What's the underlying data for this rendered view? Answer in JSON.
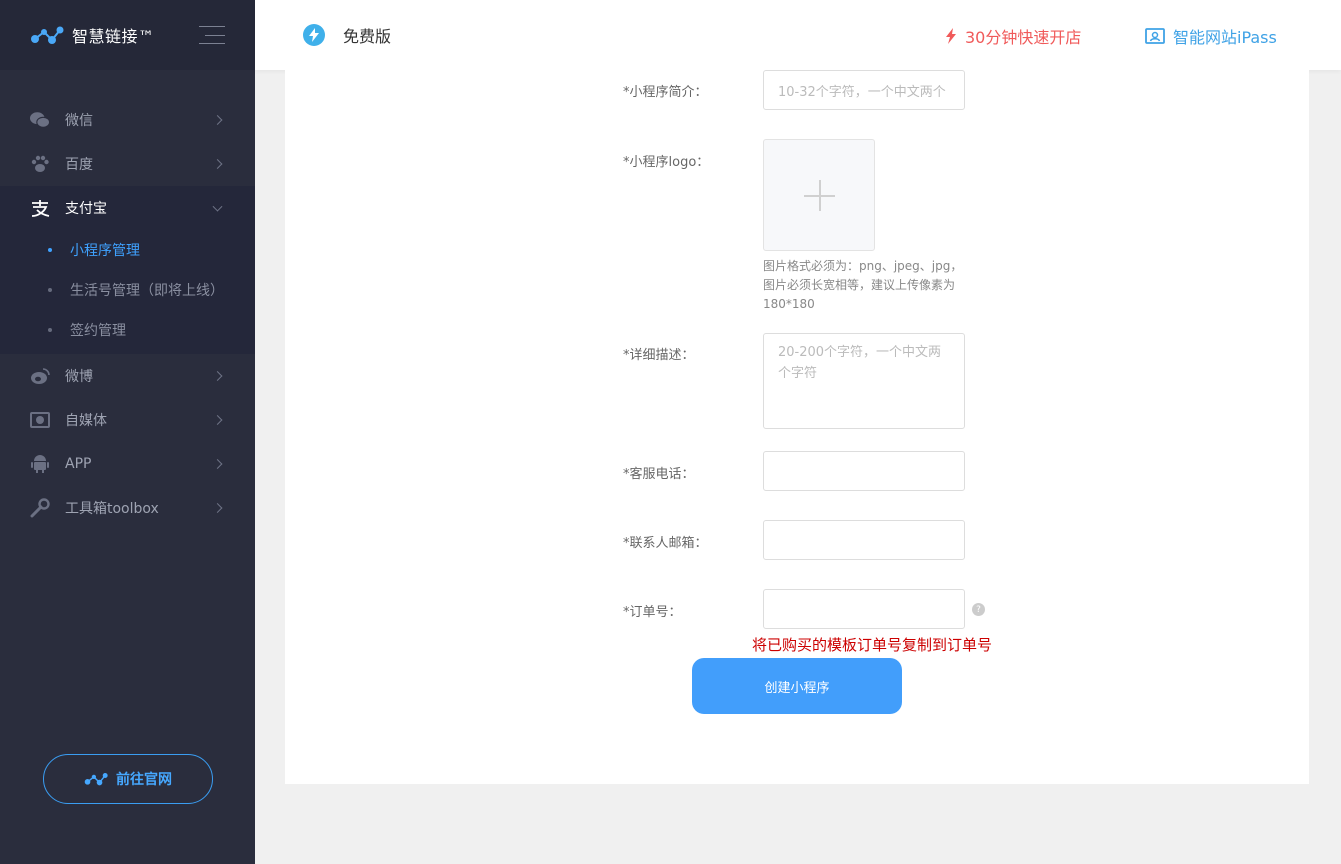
{
  "brand": {
    "name": "智慧链接™"
  },
  "sidebar": {
    "items": [
      {
        "label": "微信",
        "icon": "wechat-icon"
      },
      {
        "label": "百度",
        "icon": "paw-icon"
      },
      {
        "label": "支付宝",
        "icon": "alipay-icon",
        "expanded": true
      },
      {
        "label": "微博",
        "icon": "weibo-icon"
      },
      {
        "label": "自媒体",
        "icon": "camera-icon"
      },
      {
        "label": "APP",
        "icon": "android-icon"
      },
      {
        "label": "工具箱toolbox",
        "icon": "wrench-icon"
      }
    ],
    "alipay_sub": [
      {
        "label": "小程序管理",
        "active": true
      },
      {
        "label": "生活号管理（即将上线）"
      },
      {
        "label": "签约管理"
      }
    ],
    "goto_label": "前往官网"
  },
  "header": {
    "edition": "免费版",
    "quick_open": "30分钟快速开店",
    "ipass": "智能网站iPass"
  },
  "form": {
    "intro_label": "*小程序简介：",
    "intro_placeholder": "10-32个字符，一个中文两个",
    "logo_label": "*小程序logo：",
    "logo_hint": "图片格式必须为：png、jpeg、jpg，图片必须长宽相等，建议上传像素为180*180",
    "desc_label": "*详细描述：",
    "desc_placeholder": "20-200个字符，一个中文两个字符",
    "phone_label": "*客服电话：",
    "email_label": "*联系人邮箱：",
    "order_label": "*订单号：",
    "order_note": "将已购买的模板订单号复制到订单号",
    "submit_label": "创建小程序"
  },
  "colors": {
    "sidebar_bg": "#2a2d3d",
    "accent_blue": "#429efb",
    "quick_red": "#f05a5a",
    "note_red": "#cc0000"
  }
}
